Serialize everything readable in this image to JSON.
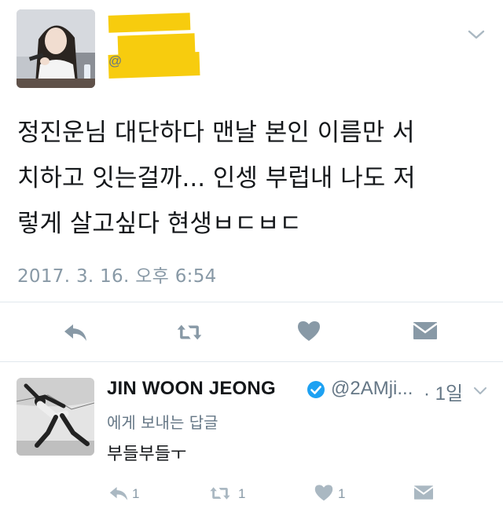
{
  "tweet": {
    "text_line1": "정진운님 대단하다 맨날 본인 이름만 서",
    "text_line2": "치하고 잇는걸까... 인셍 부럽내 나도 저",
    "text_line3": "렇게 살고싶다 현생ㅂㄷㅂㄷ",
    "timestamp": "2017. 3. 16. 오후 6:54",
    "actions": [
      "reply-icon",
      "retweet-icon",
      "like-icon",
      "message-icon"
    ]
  },
  "reply": {
    "name": "JIN WOON JEONG",
    "handle": "@2AMji...",
    "time": "· 1일",
    "context": "에게 보내는 답글",
    "body": "부들부들ㅜ",
    "reply_count": "1",
    "retweet_count": "1",
    "like_count": "1"
  },
  "colors": {
    "text": "#14171a",
    "secondary": "#657786",
    "icon": "#8899a6",
    "verified": "#1da1f2",
    "redaction": "#f7cc0e"
  }
}
